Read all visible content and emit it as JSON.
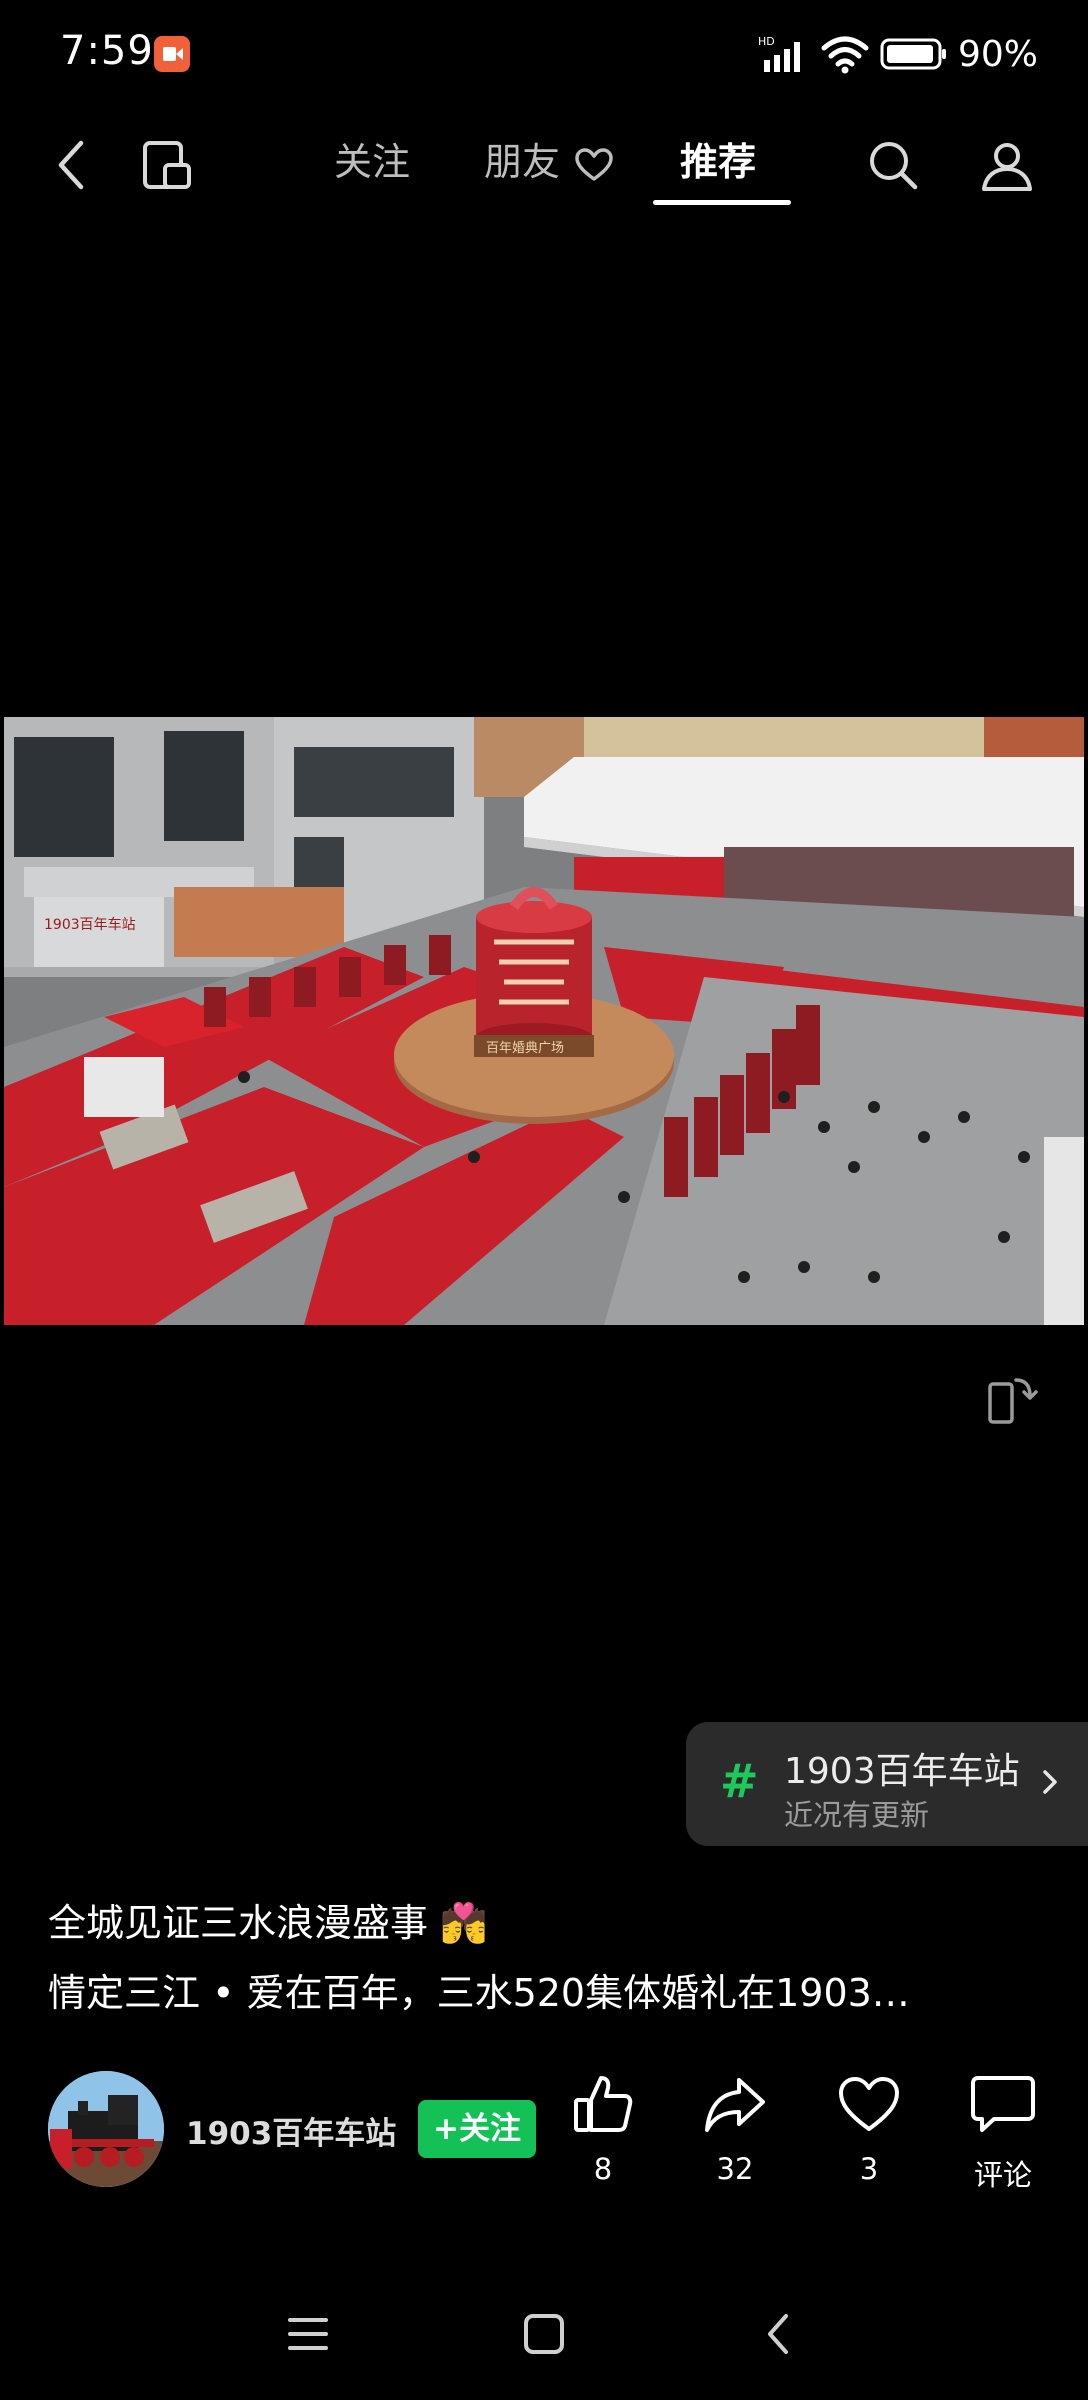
{
  "status_bar": {
    "time": "7:59",
    "network_badge": "HD",
    "battery": "90%",
    "icons": [
      "screen-record-icon",
      "signal-icon",
      "wifi-icon",
      "battery-icon"
    ]
  },
  "top_nav": {
    "tabs": [
      {
        "label": "关注"
      },
      {
        "label": "朋友"
      },
      {
        "label": "推荐"
      }
    ],
    "active_tab": "推荐",
    "icons": [
      "back-icon",
      "multi-window-icon",
      "heart-icon",
      "search-icon",
      "profile-icon"
    ]
  },
  "video": {
    "scene_text": "百年婚典广场",
    "building_sign": "1903百年车站"
  },
  "topic": {
    "hash": "#",
    "title": "1903百年车站",
    "subtitle": "近况有更新"
  },
  "caption": {
    "title": "全城见证三水浪漫盛事 💏",
    "body": "情定三江 • 爱在百年，三水520集体婚礼在1903…"
  },
  "author": {
    "name": "1903百年车站",
    "follow_label": "+关注"
  },
  "actions": {
    "like": "8",
    "share": "32",
    "favorite": "3",
    "comment": "评论"
  },
  "colors": {
    "accent_green": "#13c156",
    "topic_green": "#1ec95c",
    "carpet_red": "#c8202a",
    "record_orange": "#f0613a"
  }
}
